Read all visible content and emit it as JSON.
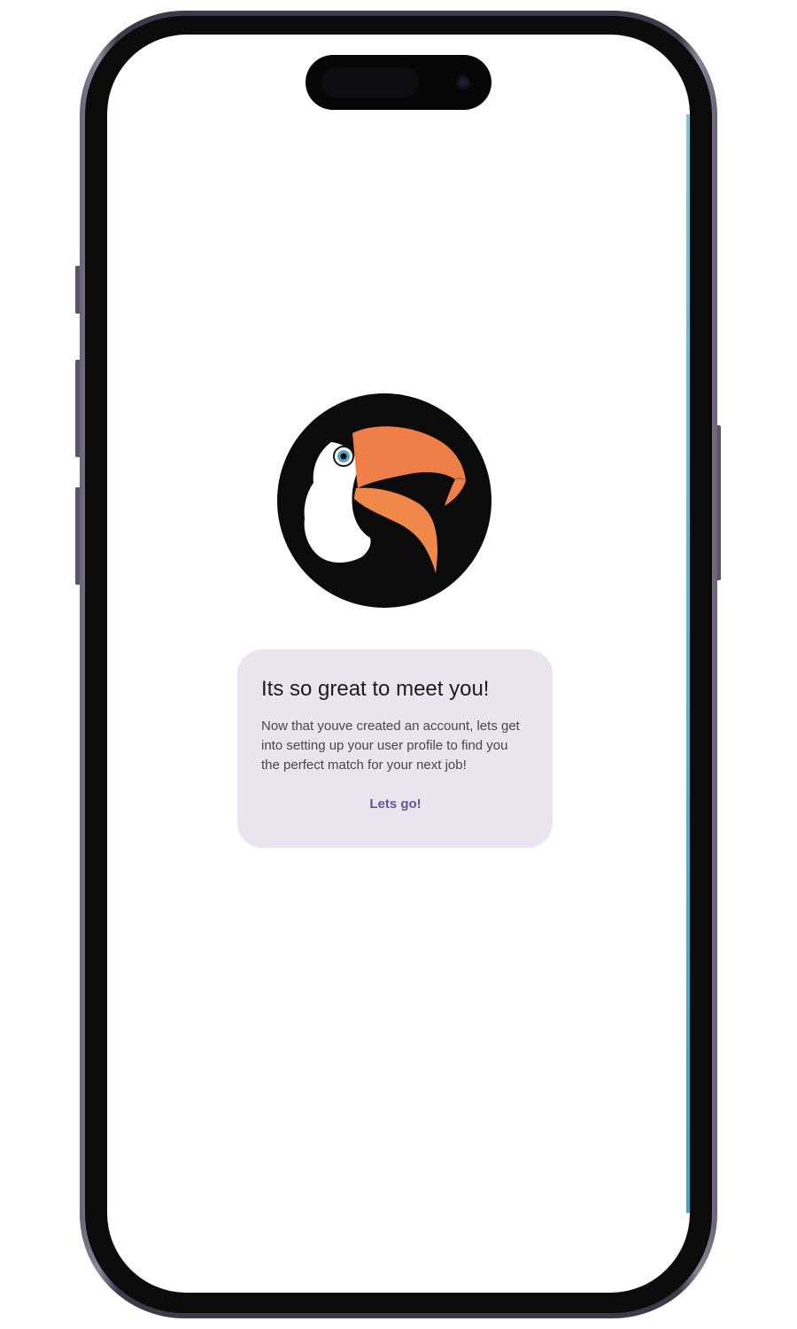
{
  "device": {
    "frame_color": "#3f3a48",
    "bezel_color": "#0b0b0c",
    "screen_color": "#ffffff"
  },
  "logo": {
    "icon": "toucan-logo",
    "colors": {
      "circle": "#0b0b0c",
      "beak": "#ef7f48",
      "beak_lower": "#f0884a",
      "chest": "#ffffff",
      "eye": "#5aa3c7"
    }
  },
  "dialog": {
    "title": "Its so great to meet you!",
    "body": "Now that youve created an account, lets get into setting up your user profile to find you the perfect match for your next job!",
    "action_label": "Lets go!",
    "background": "#ebe5ef",
    "accent": "#65558f"
  }
}
